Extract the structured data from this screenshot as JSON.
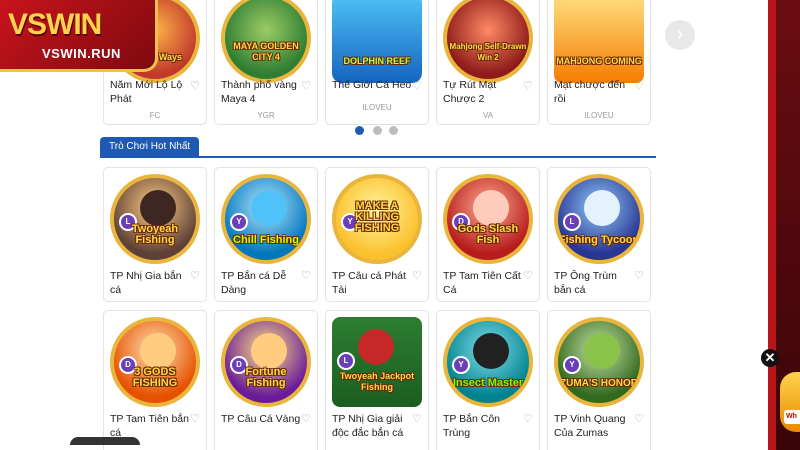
{
  "logo": {
    "main": "VSWIN",
    "sub": "VSWIN.RUN"
  },
  "top_games": [
    {
      "title": "Năm Mới Lộ Lộ Phát",
      "provider": "FC",
      "art": "w Year Ways"
    },
    {
      "title": "Thành phố vàng Maya 4",
      "provider": "YGR",
      "art": "MAYA GOLDEN CITY 4"
    },
    {
      "title": "Thế Giới Cá Heo",
      "provider": "ILOVEU",
      "art": "DOLPHIN REEF"
    },
    {
      "title": "Tự Rút Mạt Chược 2",
      "provider": "VA",
      "art": "Mahjong Self-Drawn Win 2"
    },
    {
      "title": "Mạt chược đến rồi",
      "provider": "ILOVEU",
      "art": "MAHJONG COMING"
    }
  ],
  "carousel": {
    "next_icon": "chevron-right-icon"
  },
  "section": {
    "title": "Trò Chơi Hot Nhất"
  },
  "hot_games": [
    {
      "title": "TP Nhị Gia bắn cá",
      "art": "Twoyeah Fishing",
      "chip": "L"
    },
    {
      "title": "TP Bắn cá Dễ Dàng",
      "art": "Chill Fishing",
      "chip": "Y"
    },
    {
      "title": "TP Câu cá Phát Tài",
      "art": "MAKE A KILLING FISHING",
      "chip": "Y"
    },
    {
      "title": "TP Tam Tiên Cất Cá",
      "art": "Gods Slash Fish",
      "chip": "D"
    },
    {
      "title": "TP Ông Trùm bắn cá",
      "art": "Fishing Tycoon",
      "chip": "L"
    },
    {
      "title": "TP Tam Tiên bắn cá",
      "art": "3 GODS FISHING",
      "chip": "D"
    },
    {
      "title": "TP Câu Cá Vàng",
      "art": "Fortune Fishing",
      "chip": "D"
    },
    {
      "title": "TP Nhị Gia giải độc đắc bắn cá",
      "art": "Twoyeah Jackpot Fishing",
      "chip": "L"
    },
    {
      "title": "TP Bắn Côn Trùng",
      "art": "Insect Master",
      "chip": "Y"
    },
    {
      "title": "TP Vinh Quang Của Zumas",
      "art": "ZUMA'S HONOR",
      "chip": "Y"
    }
  ],
  "colors": {
    "accent": "#1e5ab4",
    "brand_red": "#c8141c",
    "gold": "#e9b53c"
  }
}
